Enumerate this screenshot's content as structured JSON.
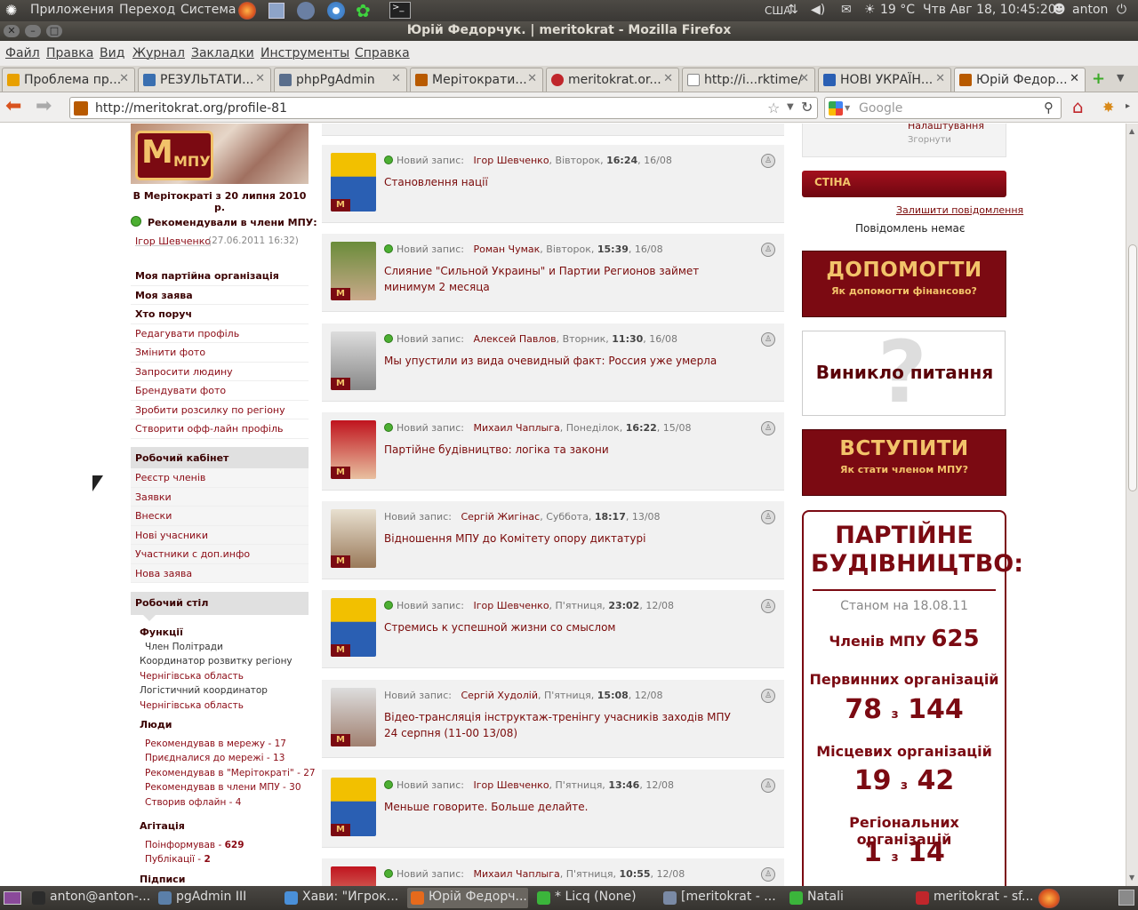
{
  "system": {
    "menus": [
      "Приложения",
      "Переход",
      "Система"
    ],
    "locale": "США",
    "weather": "19 °C",
    "datetime": "Чтв Авг 18, 10:45:20",
    "user": "anton"
  },
  "window": {
    "title": "Юрій Федорчук. | meritokrat - Mozilla Firefox"
  },
  "menubar": [
    "Файл",
    "Правка",
    "Вид",
    "Журнал",
    "Закладки",
    "Инструменты",
    "Справка"
  ],
  "tabs": [
    {
      "label": "Проблема пр...",
      "color": "#e8a000"
    },
    {
      "label": "РЕЗУЛЬТАТИ...",
      "color": "#3a6fb0"
    },
    {
      "label": "phpPgAdmin",
      "color": "#5a6e8c"
    },
    {
      "label": "Мерітократи...",
      "color": "#b85a00"
    },
    {
      "label": "meritokrat.or...",
      "color": "#c0262b"
    },
    {
      "label": "http://i...rktime/",
      "color": "#ffffff"
    },
    {
      "label": "НОВІ УКРАЇН...",
      "color": "#2a5fb3"
    },
    {
      "label": "Юрій Федор...",
      "color": "#b85a00"
    }
  ],
  "nav": {
    "url": "http://meritokrat.org/profile-81",
    "search_placeholder": "Google"
  },
  "profile": {
    "since": "В Мерітократі з 20 липня 2010 р.",
    "recommended_label": "Рекомендували в члени МПУ:",
    "recommender": "Ігор Шевченко",
    "recommender_date": "(27.06.2011 16:32)",
    "logo_text": "МПУ"
  },
  "links_bold": [
    "Моя партійна організація",
    "Моя заява",
    "Хто поруч"
  ],
  "links": [
    "Редагувати профіль",
    "Змінити фото",
    "Запросити людину",
    "Брендувати фото",
    "Зробити розсилку по регіону",
    "Створити офф-лайн профіль"
  ],
  "cabinet": {
    "title": "Робочий кабінет",
    "items": [
      "Реєстр членів",
      "Заявки",
      "Внески",
      "Нові учасники",
      "Участники с доп.инфо",
      "Нова заява"
    ]
  },
  "desk": {
    "title": "Робочий стіл",
    "functions_label": "Функції",
    "functions": [
      "Член Політради",
      "Координатор розвитку регіону",
      "Чернігівська область",
      "Логістичний координатор",
      "Чернігівська область"
    ],
    "people_label": "Люди",
    "people": [
      "Рекомендував в мережу - 17",
      "Приєдналися до мережі - 13",
      "Рекомендував в \"Мерітократі\" - 27",
      "Рекомендував в члени МПУ - 30",
      "Створив офлайн - 4"
    ],
    "agitation_label": "Агітація",
    "agitation": [
      {
        "label": "Поінформував - ",
        "value": "629"
      },
      {
        "label": "Публікації - ",
        "value": "2"
      }
    ],
    "signatures_label": "Підписи"
  },
  "feed": [
    {
      "prefix": "Новий запис:",
      "author": "Ігор Шевченко",
      "day": ", Вівторок, ",
      "time": "16:24",
      "date": ", 16/08",
      "title": "Становлення нації",
      "online": true
    },
    {
      "prefix": "Новий запис:",
      "author": "Роман Чумак",
      "day": ", Вівторок, ",
      "time": "15:39",
      "date": ", 16/08",
      "title": "Слияние \"Сильной Украины\" и Партии Регионов займет минимум 2 месяца",
      "online": true
    },
    {
      "prefix": "Новий запис:",
      "author": "Алексей Павлов",
      "day": ", Вторник, ",
      "time": "11:30",
      "date": ", 16/08",
      "title": "Мы упустили из вида очевидный факт: Россия уже умерла",
      "online": true
    },
    {
      "prefix": "Новий запис:",
      "author": "Михаил Чаплыга",
      "day": ", Понеділок, ",
      "time": "16:22",
      "date": ", 15/08",
      "title": "Партійне будівництво: логіка та закони",
      "online": true
    },
    {
      "prefix": "Новий запис:",
      "author": "Сергій Жигінас",
      "day": ", Суббота, ",
      "time": "18:17",
      "date": ", 13/08",
      "title": "Відношення МПУ до Комітету опору диктатурі",
      "online": false
    },
    {
      "prefix": "Новий запис:",
      "author": "Ігор Шевченко",
      "day": ", П'ятниця, ",
      "time": "23:02",
      "date": ", 12/08",
      "title": "Стремись к успешной жизни со смыслом",
      "online": true
    },
    {
      "prefix": "Новий запис:",
      "author": "Сергій Худолій",
      "day": ", П'ятниця, ",
      "time": "15:08",
      "date": ", 12/08",
      "title": "Відео-трансляція інструктаж-тренінгу учасників заходів МПУ 24 серпня (11-00 13/08)",
      "online": false
    },
    {
      "prefix": "Новий запис:",
      "author": "Ігор Шевченко",
      "day": ", П'ятниця, ",
      "time": "13:46",
      "date": ", 12/08",
      "title": "Меньше говорите. Больше делайте.",
      "online": true
    },
    {
      "prefix": "Новий запис:",
      "author": "Михаил Чаплыга",
      "day": ", П'ятниця, ",
      "time": "10:55",
      "date": ", 12/08",
      "title": "",
      "online": true
    }
  ],
  "right": {
    "settings": "Налаштування",
    "collapse": "Згорнути",
    "wall_title": "СТІНА",
    "leave_message": "Залишити повідомлення",
    "no_messages": "Повідомлень немає",
    "help_big": "ДОПОМОГТИ",
    "help_small": "Як допомогти фінансово?",
    "question": "Виникло питання",
    "join_big": "ВСТУПИТИ",
    "join_small": "Як стати членом МПУ?",
    "stats_title": "ПАРТІЙНЕ БУДІВНИЦТВО:",
    "as_of": "Станом на  18.08.11",
    "members_label": "Членів МПУ",
    "members_value": "625",
    "primary_label": "Первинних організацій",
    "primary_value": "78",
    "primary_total": "144",
    "local_label": "Місцевих організацій",
    "local_value": "19",
    "local_total": "42",
    "regional_label": "Регіональних організацій",
    "regional_value": "1",
    "regional_total": "14",
    "of": "з"
  },
  "taskbar": [
    {
      "label": "anton@anton-...",
      "color": "#2b2b2b"
    },
    {
      "label": "pgAdmin III",
      "color": "#5b7fa8"
    },
    {
      "label": "Хави: \"Игрок...",
      "color": "#4a90d9"
    },
    {
      "label": "Юрій Федорч...",
      "color": "#e66a1c"
    },
    {
      "label": "* Licq (None)",
      "color": "#3bb53b"
    },
    {
      "label": "[meritokrat - ...",
      "color": "#7a8aa5"
    },
    {
      "label": "Natali",
      "color": "#3bb53b"
    },
    {
      "label": "meritokrat - sf...",
      "color": "#c0262b"
    }
  ],
  "colors": {
    "brand": "#7b0a12",
    "link": "#7a0a0a",
    "banner_text": "#f2c36a",
    "online": "#4caf32"
  }
}
